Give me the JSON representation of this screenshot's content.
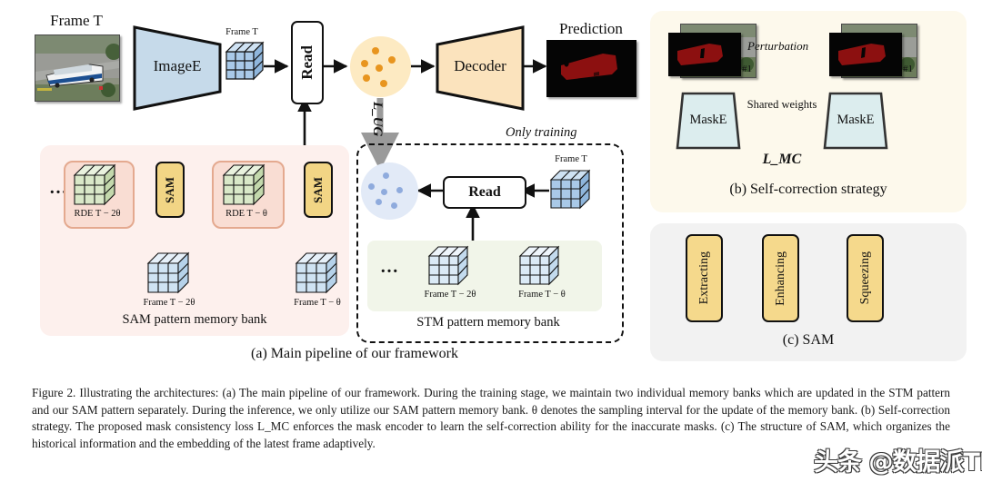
{
  "figure": {
    "number": "Figure 2.",
    "caption": "Figure 2.  Illustrating the architectures: (a) The main pipeline of our framework. During the training stage, we maintain two individual memory banks which are updated in the STM pattern and our SAM pattern separately. During the inference, we only utilize our SAM pattern memory bank. θ denotes the sampling interval for the update of the memory bank. (b) Self-correction strategy. The proposed mask consistency loss L_MC enforces the mask encoder to learn the self-correction ability for the inaccurate masks. (c) The structure of SAM, which organizes the historical information and the embedding of the latest frame adaptively."
  },
  "panel_a": {
    "sub_caption": "(a) Main pipeline of our framework",
    "input_image_label": "Frame T",
    "encoder_label": "ImageE",
    "encoder_feature_label": "Frame T",
    "read_label": "Read",
    "decoder_label": "Decoder",
    "prediction_label": "Prediction",
    "loss_label": "L_UG",
    "only_training_label": "Only training",
    "sam_bank": {
      "ellipsis": "…",
      "title": "SAM pattern memory bank",
      "rde_labels": [
        "RDE T − 2θ",
        "RDE T − θ"
      ],
      "sam_label": "SAM",
      "frame_labels": [
        "Frame T − 2θ",
        "Frame T − θ"
      ]
    },
    "stm_bank": {
      "ellipsis": "…",
      "title": "STM pattern memory bank",
      "read_label": "Read",
      "current_frame_label": "Frame T",
      "frame_labels": [
        "Frame T − 2θ",
        "Frame T − θ"
      ]
    }
  },
  "panel_b": {
    "sub_caption": "(b) Self-correction strategy",
    "perturbation_label": "Perturbation",
    "mask_index_left": "#1",
    "mask_index_right": "#1",
    "encoder_left_label": "MaskE",
    "encoder_right_label": "MaskE",
    "shared_weights_label": "Shared weights",
    "loss_label": "L_MC"
  },
  "panel_c": {
    "sub_caption": "(c) SAM",
    "blocks": [
      "Extracting",
      "Enhancing",
      "Squeezing"
    ],
    "sum_symbol": "⊕"
  },
  "watermark": {
    "text": "头条 @数据派THU"
  },
  "colors": {
    "image_encoder_fill": "#c6daea",
    "decoder_fill": "#fbe3bd",
    "mask_encoder_fill": "#dcedee",
    "sam_block_fill": "#f2d585",
    "orange_circle": "#fdeac2",
    "orange_dot": "#e8951f",
    "blue_circle": "#e2eaf7",
    "blue_dot": "#8fabdd",
    "sam_panel_bg": "#fdf0ed",
    "rde_box_bg": "#f9ddd3",
    "stm_inner_bg": "#f1f5e9",
    "panel_b_bg": "#fdf9ec",
    "panel_c_bg": "#f2f2f2",
    "prediction_mask": "#8c1010",
    "loss_arrow_gray": "#9a9a9a",
    "stroke": "#111111"
  }
}
